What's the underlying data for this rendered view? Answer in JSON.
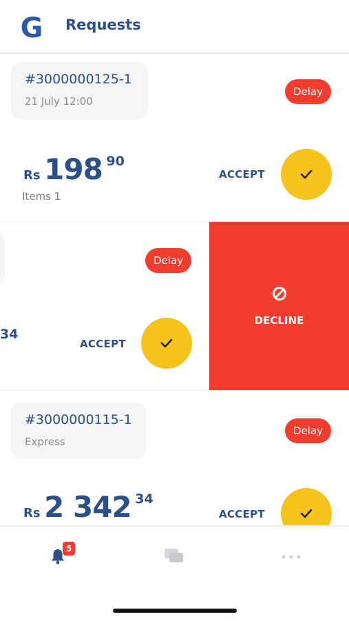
{
  "header": {
    "title": "Requests",
    "logo_letter": "G"
  },
  "requests": [
    {
      "order_id": "#3000000125-1",
      "subtitle": "21 July 12:00",
      "delay_label": "Delay",
      "currency": "Rs",
      "price_int": "198",
      "price_dec": "90",
      "items": "Items 1",
      "accept_label": "ACCEPT"
    },
    {
      "delay_label": "Delay",
      "price_dec": "34",
      "accept_label": "ACCEPT",
      "decline_label": "DECLINE"
    },
    {
      "order_id": "#3000000115-1",
      "subtitle": "Express",
      "delay_label": "Delay",
      "currency": "Rs",
      "price_int": "2 342",
      "price_dec": "34",
      "accept_label": "ACCEPT"
    }
  ],
  "tabbar": {
    "notifications_badge": "5"
  },
  "colors": {
    "primary": "#2d4f88",
    "danger": "#f23c2e",
    "accept": "#f6c21b"
  }
}
